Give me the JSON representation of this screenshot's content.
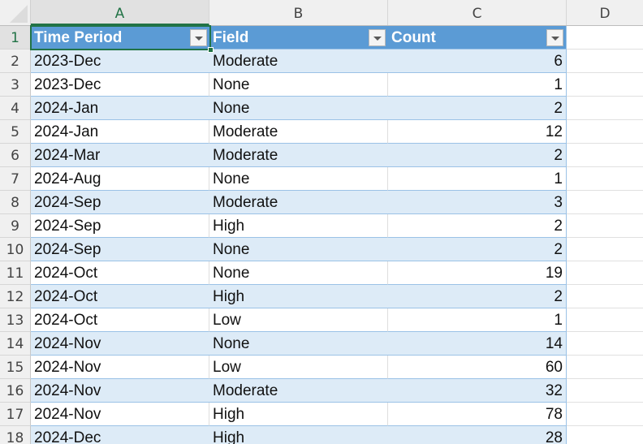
{
  "columns": [
    "A",
    "B",
    "C",
    "D"
  ],
  "active_cell": "A1",
  "table": {
    "headers": [
      "Time Period",
      "Field",
      "Count"
    ],
    "filter_icon": "dropdown-filter-icon",
    "rows": [
      {
        "row": "2",
        "time_period": "2023-Dec",
        "field": "Moderate",
        "count": "6"
      },
      {
        "row": "3",
        "time_period": "2023-Dec",
        "field": "None",
        "count": "1"
      },
      {
        "row": "4",
        "time_period": "2024-Jan",
        "field": "None",
        "count": "2"
      },
      {
        "row": "5",
        "time_period": "2024-Jan",
        "field": "Moderate",
        "count": "12"
      },
      {
        "row": "6",
        "time_period": "2024-Mar",
        "field": "Moderate",
        "count": "2"
      },
      {
        "row": "7",
        "time_period": "2024-Aug",
        "field": "None",
        "count": "1"
      },
      {
        "row": "8",
        "time_period": "2024-Sep",
        "field": "Moderate",
        "count": "3"
      },
      {
        "row": "9",
        "time_period": "2024-Sep",
        "field": "High",
        "count": "2"
      },
      {
        "row": "10",
        "time_period": "2024-Sep",
        "field": "None",
        "count": "2"
      },
      {
        "row": "11",
        "time_period": "2024-Oct",
        "field": "None",
        "count": "19"
      },
      {
        "row": "12",
        "time_period": "2024-Oct",
        "field": "High",
        "count": "2"
      },
      {
        "row": "13",
        "time_period": "2024-Oct",
        "field": "Low",
        "count": "1"
      },
      {
        "row": "14",
        "time_period": "2024-Nov",
        "field": "None",
        "count": "14"
      },
      {
        "row": "15",
        "time_period": "2024-Nov",
        "field": "Low",
        "count": "60"
      },
      {
        "row": "16",
        "time_period": "2024-Nov",
        "field": "Moderate",
        "count": "32"
      },
      {
        "row": "17",
        "time_period": "2024-Nov",
        "field": "High",
        "count": "78"
      },
      {
        "row": "18",
        "time_period": "2024-Dec",
        "field": "High",
        "count": "28"
      }
    ]
  },
  "header_row_number": "1",
  "colors": {
    "table_header_bg": "#5B9BD5",
    "band_blue": "#DDEBF7",
    "band_border": "#9BC2E6",
    "selection": "#217346"
  }
}
